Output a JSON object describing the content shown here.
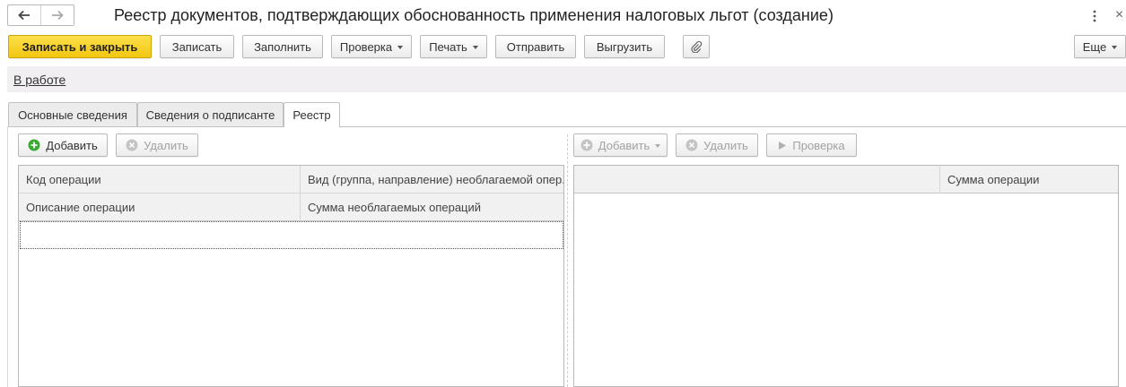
{
  "window": {
    "title": "Реестр документов, подтверждающих обоснованность применения налоговых льгот (создание)"
  },
  "toolbar": {
    "save_close_label": "Записать и закрыть",
    "save_label": "Записать",
    "fill_label": "Заполнить",
    "check_label": "Проверка",
    "print_label": "Печать",
    "send_label": "Отправить",
    "export_label": "Выгрузить",
    "more_label": "Еще"
  },
  "status": {
    "link_label": "В работе"
  },
  "tabs": [
    {
      "label": "Основные сведения",
      "active": false
    },
    {
      "label": "Сведения о подписанте",
      "active": false
    },
    {
      "label": "Реестр",
      "active": true
    }
  ],
  "left_panel": {
    "add_label": "Добавить",
    "delete_label": "Удалить",
    "columns": {
      "op_code": "Код операции",
      "op_kind": "Вид (группа, направление) необлагаемой опер.",
      "op_description": "Описание операции",
      "untaxed_sum": "Сумма необлагаемых операций"
    }
  },
  "right_panel": {
    "add_label": "Добавить",
    "delete_label": "Удалить",
    "check_label": "Проверка",
    "columns": {
      "empty": "",
      "op_sum": "Сумма операции"
    }
  },
  "colors": {
    "accent_yellow": "#f6d21f",
    "add_green": "#3aaa35",
    "disabled_gray": "#a3a3a3",
    "status_strip": "#f2eff3"
  }
}
